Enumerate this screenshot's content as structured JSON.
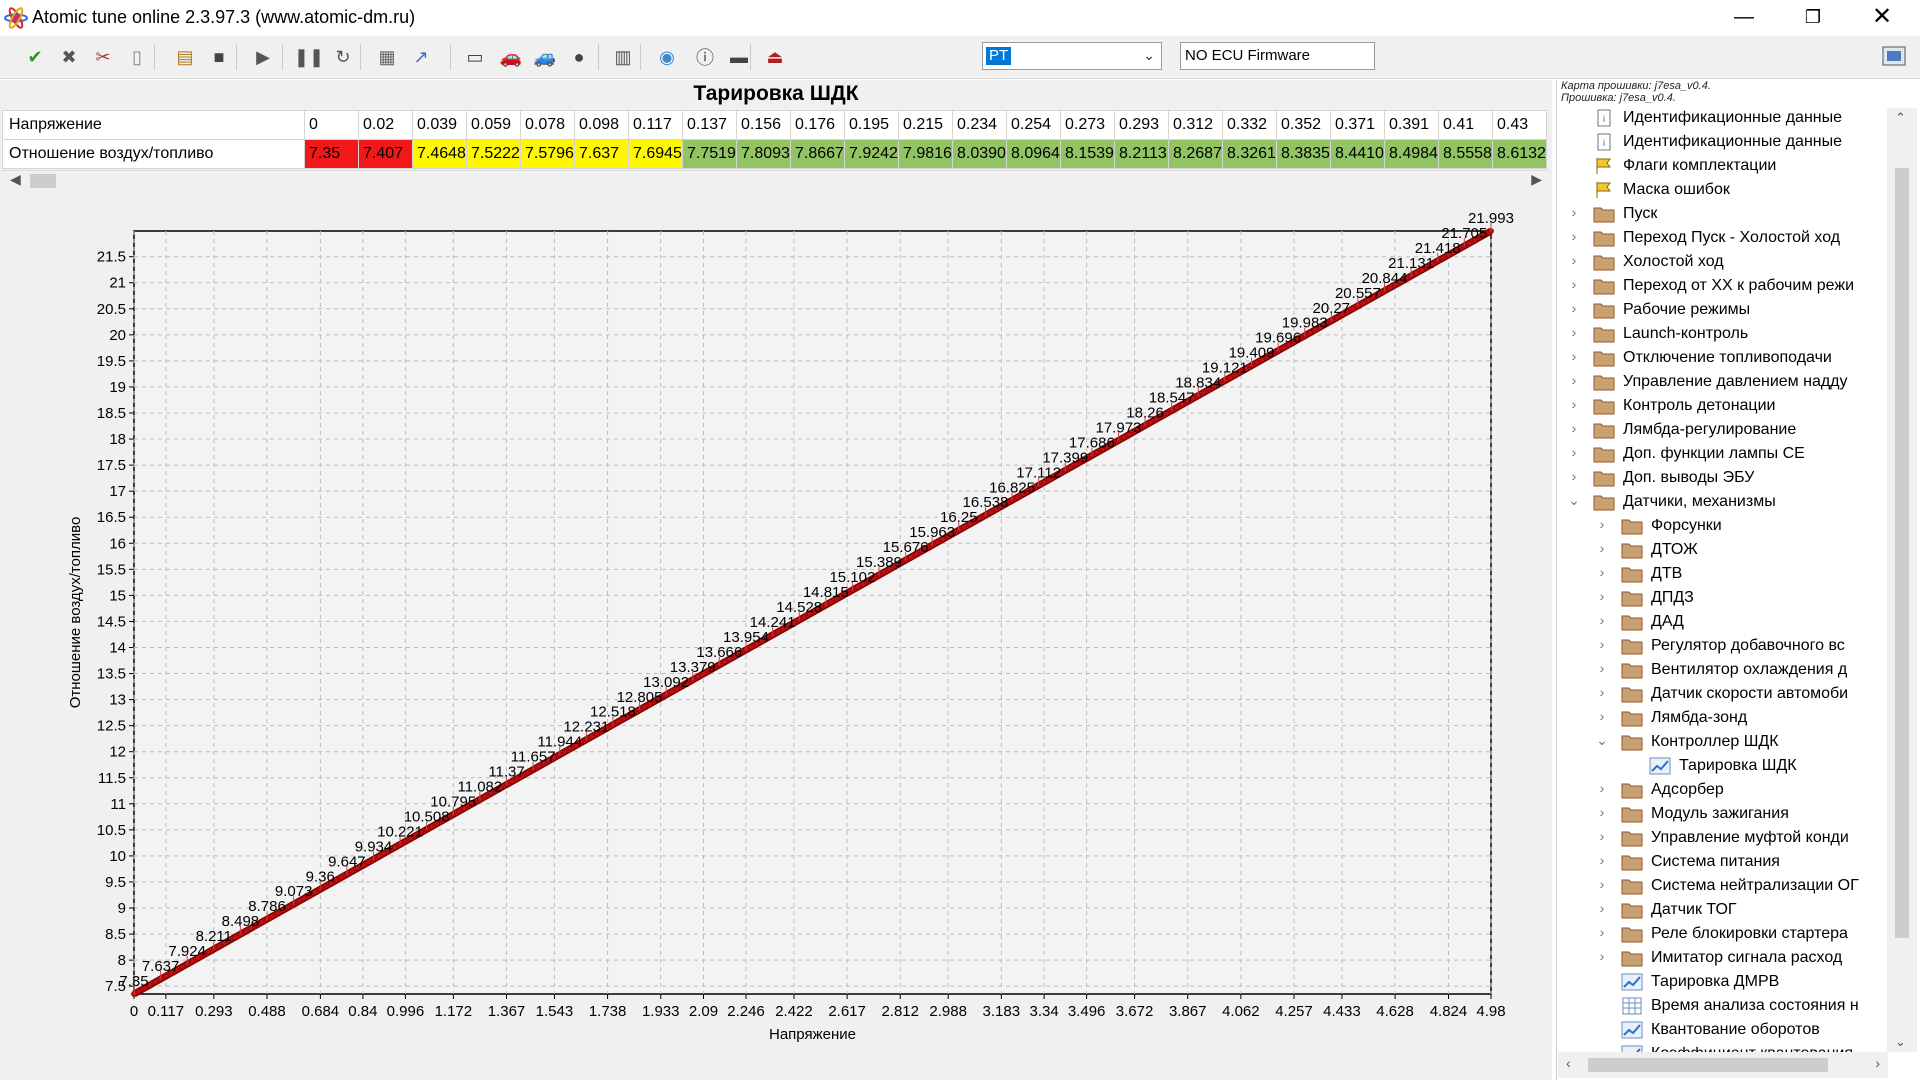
{
  "window": {
    "title": "Atomic tune online 2.3.97.3 (www.atomic-dm.ru)"
  },
  "toolbar": {
    "icons": [
      "check-icon",
      "cancel-icon",
      "tools-icon",
      "document-icon",
      "copy-icon",
      "stop-icon",
      "play-icon",
      "pause-icon",
      "refresh-icon",
      "table-icon",
      "graph-icon",
      "monitor-icon",
      "car-icon",
      "car2-icon",
      "car3-icon",
      "bars-icon",
      "globe-icon",
      "info-icon",
      "display-icon",
      "exit-icon"
    ],
    "combo_value": "PT",
    "firmware_label": "NO ECU Firmware"
  },
  "table": {
    "title": "Тарировка ШДК",
    "row1_label": "Напряжение",
    "row2_label": "Отношение воздух/топливо",
    "row1": [
      "0",
      "0.02",
      "0.039",
      "0.059",
      "0.078",
      "0.098",
      "0.117",
      "0.137",
      "0.156",
      "0.176",
      "0.195",
      "0.215",
      "0.234",
      "0.254",
      "0.273",
      "0.293",
      "0.312",
      "0.332",
      "0.352",
      "0.371",
      "0.391",
      "0.41",
      "0.43"
    ],
    "row2": [
      "7.35",
      "7.407",
      "7.4648",
      "7.5222",
      "7.5796",
      "7.637",
      "7.6945",
      "7.7519",
      "7.8093",
      "7.8667",
      "7.9242",
      "7.9816",
      "8.0390",
      "8.0964",
      "8.1539",
      "8.2113",
      "8.2687",
      "8.3261",
      "8.3835",
      "8.4410",
      "8.4984",
      "8.5558",
      "8.6132"
    ]
  },
  "colors": {
    "red": "#f01818",
    "yellow": "#fff700",
    "green": "#92c464",
    "line": "#d92424"
  },
  "chart_data": {
    "type": "line",
    "xlabel": "Напряжение",
    "ylabel": "Отношение воздух/топливо",
    "xlim": [
      0,
      4.98
    ],
    "ylim": [
      7.35,
      21.993
    ],
    "grid": true,
    "x_ticks": [
      "0",
      "0.117",
      "0.293",
      "0.488",
      "0.684",
      "0.84",
      "0.996",
      "1.172",
      "1.367",
      "1.543",
      "1.738",
      "1.933",
      "2.09",
      "2.246",
      "2.422",
      "2.617",
      "2.812",
      "2.988",
      "3.183",
      "3.34",
      "3.496",
      "3.672",
      "3.867",
      "4.062",
      "4.257",
      "4.433",
      "4.628",
      "4.824",
      "4.98"
    ],
    "y_ticks": [
      "7.5",
      "8",
      "8.5",
      "9",
      "9.5",
      "10",
      "10.5",
      "11",
      "11.5",
      "12",
      "12.5",
      "13",
      "13.5",
      "14",
      "14.5",
      "15",
      "15.5",
      "16",
      "16.5",
      "17",
      "17.5",
      "18",
      "18.5",
      "19",
      "19.5",
      "20",
      "20.5",
      "21",
      "21.5"
    ],
    "series": [
      {
        "x": [
          0,
          4.98
        ],
        "values": [
          7.35,
          21.993
        ]
      }
    ],
    "labels": [
      "7.35",
      "7.637",
      "7.924",
      "8.211",
      "8.498",
      "8.786",
      "9.073",
      "9.36",
      "9.647",
      "9.934",
      "10.221",
      "10.508",
      "10.795",
      "11.082",
      "11.37",
      "11.657",
      "11.944",
      "12.231",
      "12.518",
      "12.805",
      "13.092",
      "13.379",
      "13.666",
      "13.954",
      "14.241",
      "14.528",
      "14.815",
      "15.102",
      "15.389",
      "15.676",
      "15.963",
      "16.25",
      "16.538",
      "16.825",
      "17.112",
      "17.399",
      "17.686",
      "17.973",
      "18.26",
      "18.547",
      "18.834",
      "19.121",
      "19.409",
      "19.696",
      "19.983",
      "20.27",
      "20.557",
      "20.844",
      "21.131",
      "21.418",
      "21.705",
      "21.993"
    ]
  },
  "tree": {
    "info_line1": "Карта прошивки: j7esa_v0.4.",
    "info_line2": "Прошивка: j7esa_v0.4.",
    "items": [
      {
        "label": "Идентификационные данные",
        "level": 1,
        "type": "doc",
        "exp": ""
      },
      {
        "label": "Идентификационные данные",
        "level": 1,
        "type": "doc",
        "exp": ""
      },
      {
        "label": "Флаги комплектации",
        "level": 1,
        "type": "flag",
        "exp": ""
      },
      {
        "label": "Маска ошибок",
        "level": 1,
        "type": "flag",
        "exp": ""
      },
      {
        "label": "Пуск",
        "level": 1,
        "type": "folder",
        "exp": ">"
      },
      {
        "label": "Переход Пуск - Холостой ход",
        "level": 1,
        "type": "folder",
        "exp": ">"
      },
      {
        "label": "Холостой ход",
        "level": 1,
        "type": "folder",
        "exp": ">"
      },
      {
        "label": "Переход от ХХ к рабочим режи",
        "level": 1,
        "type": "folder",
        "exp": ">"
      },
      {
        "label": "Рабочие режимы",
        "level": 1,
        "type": "folder",
        "exp": ">"
      },
      {
        "label": "Launch-контроль",
        "level": 1,
        "type": "folder",
        "exp": ">"
      },
      {
        "label": "Отключение топливоподачи",
        "level": 1,
        "type": "folder",
        "exp": ">"
      },
      {
        "label": "Управление давлением надду",
        "level": 1,
        "type": "folder",
        "exp": ">"
      },
      {
        "label": "Контроль детонации",
        "level": 1,
        "type": "folder",
        "exp": ">"
      },
      {
        "label": "Лямбда-регулирование",
        "level": 1,
        "type": "folder",
        "exp": ">"
      },
      {
        "label": "Доп. функции лампы СЕ",
        "level": 1,
        "type": "folder",
        "exp": ">"
      },
      {
        "label": "Доп. выводы ЭБУ",
        "level": 1,
        "type": "folder",
        "exp": ">"
      },
      {
        "label": "Датчики, механизмы",
        "level": 1,
        "type": "folder",
        "exp": "v"
      },
      {
        "label": "Форсунки",
        "level": 2,
        "type": "folder",
        "exp": ">"
      },
      {
        "label": "ДТОЖ",
        "level": 2,
        "type": "folder",
        "exp": ">"
      },
      {
        "label": "ДТВ",
        "level": 2,
        "type": "folder",
        "exp": ">"
      },
      {
        "label": "ДПДЗ",
        "level": 2,
        "type": "folder",
        "exp": ">"
      },
      {
        "label": "ДАД",
        "level": 2,
        "type": "folder",
        "exp": ">"
      },
      {
        "label": "Регулятор добавочного вс",
        "level": 2,
        "type": "folder",
        "exp": ">"
      },
      {
        "label": "Вентилятор охлаждения д",
        "level": 2,
        "type": "folder",
        "exp": ">"
      },
      {
        "label": "Датчик скорости автомоби",
        "level": 2,
        "type": "folder",
        "exp": ">"
      },
      {
        "label": "Лямбда-зонд",
        "level": 2,
        "type": "folder",
        "exp": ">"
      },
      {
        "label": "Контроллер ШДК",
        "level": 2,
        "type": "folder",
        "exp": "v"
      },
      {
        "label": "Тарировка ШДК",
        "level": 3,
        "type": "graph",
        "exp": ""
      },
      {
        "label": "Адсорбер",
        "level": 2,
        "type": "folder",
        "exp": ">"
      },
      {
        "label": "Модуль зажигания",
        "level": 2,
        "type": "folder",
        "exp": ">"
      },
      {
        "label": "Управление муфтой конди",
        "level": 2,
        "type": "folder",
        "exp": ">"
      },
      {
        "label": "Система питания",
        "level": 2,
        "type": "folder",
        "exp": ">"
      },
      {
        "label": "Система нейтрализации ОГ",
        "level": 2,
        "type": "folder",
        "exp": ">"
      },
      {
        "label": "Датчик ТОГ",
        "level": 2,
        "type": "folder",
        "exp": ">"
      },
      {
        "label": "Реле блокировки стартера",
        "level": 2,
        "type": "folder",
        "exp": ">"
      },
      {
        "label": "Имитатор сигнала расход",
        "level": 2,
        "type": "folder",
        "exp": ">"
      },
      {
        "label": "Тарировка ДМРВ",
        "level": 2,
        "type": "graph",
        "exp": ""
      },
      {
        "label": "Время анализа состояния н",
        "level": 2,
        "type": "table",
        "exp": ""
      },
      {
        "label": "Квантование оборотов",
        "level": 2,
        "type": "graph",
        "exp": ""
      },
      {
        "label": "Коэффициент квантования",
        "level": 2,
        "type": "graph",
        "exp": ""
      }
    ]
  }
}
